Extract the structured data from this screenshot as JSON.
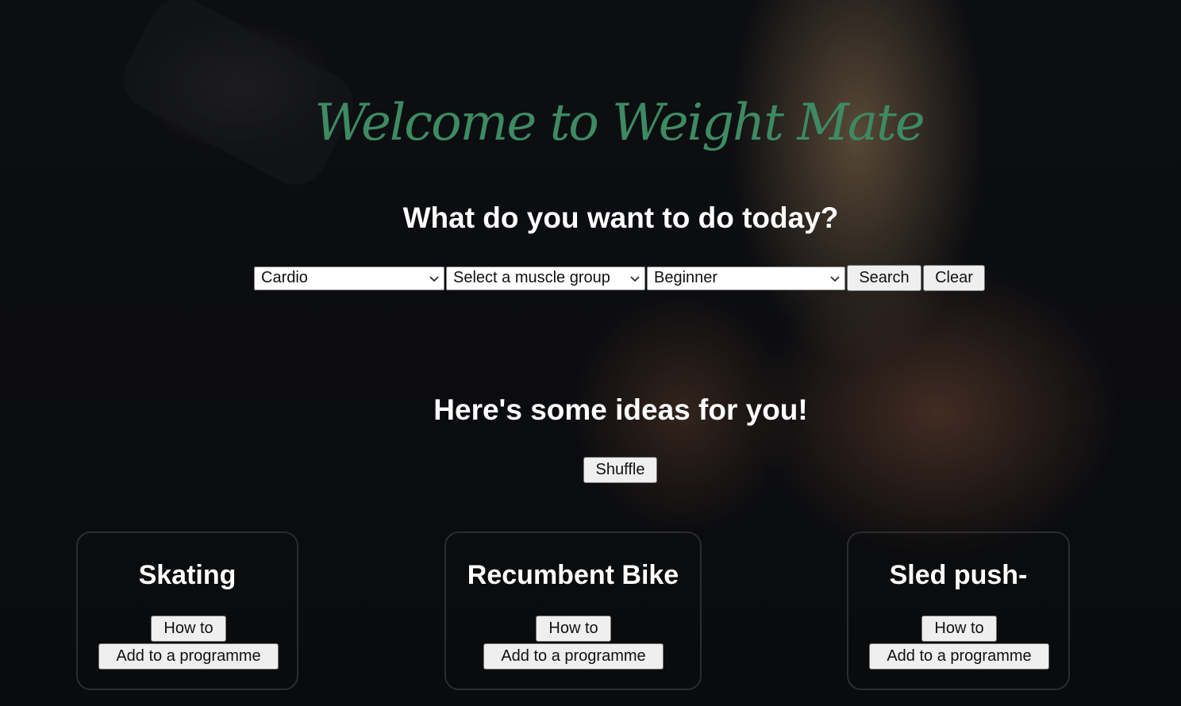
{
  "brand": {
    "title": "Welcome to Weight Mate"
  },
  "search": {
    "heading": "What do you want to do today?",
    "category_selected": "Cardio",
    "muscle_selected": "Select a muscle group",
    "level_selected": "Beginner",
    "search_label": "Search",
    "clear_label": "Clear"
  },
  "ideas": {
    "heading": "Here's some ideas for you!",
    "shuffle_label": "Shuffle",
    "cards": [
      {
        "title": "Skating",
        "howto_label": "How to",
        "add_label": "Add to a programme"
      },
      {
        "title": "Recumbent Bike",
        "howto_label": "How to",
        "add_label": "Add to a programme"
      },
      {
        "title": "Sled push-",
        "howto_label": "How to",
        "add_label": "Add to a programme"
      }
    ]
  },
  "colors": {
    "brand_green": "#3d8a63",
    "text_white": "#ffffff",
    "button_bg": "#efefef"
  }
}
